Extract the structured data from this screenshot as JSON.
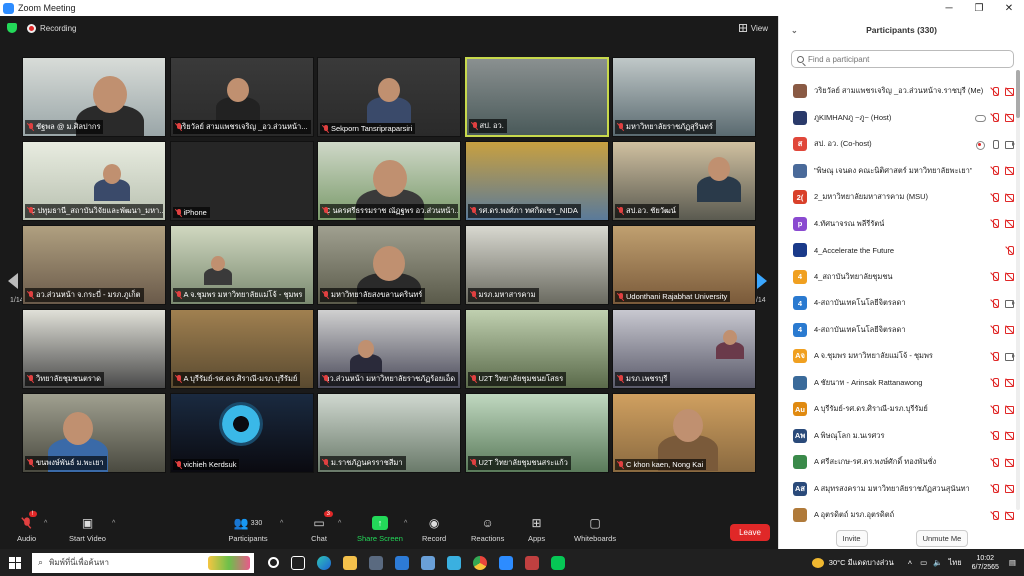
{
  "window": {
    "title": "Zoom Meeting"
  },
  "meeting": {
    "recording_label": "Recording",
    "view_label": "View",
    "page_indicator_left": "1/14",
    "page_indicator_right": "1/14",
    "tiles": [
      {
        "name": "ชัฐพล @ ม.ศิลปากร",
        "active": false
      },
      {
        "name": "วริยวัลย์  สามแพชรเจริญ _อว.ส่วนหน้า...",
        "active": false
      },
      {
        "name": "Sekporn Tansripraparsiri",
        "active": false
      },
      {
        "name": "สป. อว.",
        "active": true
      },
      {
        "name": "มหาวิทยาลัยราชภัฏสุรินทร์",
        "active": false
      },
      {
        "name": "C ปทุมธานี_สถาบันวิจัยและพัฒนา_มหา...",
        "active": false
      },
      {
        "name": "iPhone",
        "active": false
      },
      {
        "name": "C นครศรีธรรมราช ณัฏฐพร อว.ส่วนหน้า...",
        "active": false
      },
      {
        "name": "รศ.ดร.พงศ์ภา ทศกิดเชร_NIDA",
        "active": false
      },
      {
        "name": "สป.อว. ชัยวัฒน์",
        "active": false
      },
      {
        "name": "อว.ส่วนหน้า จ.กระบี่ - มรภ.ภูเก็ต",
        "active": false
      },
      {
        "name": "A จ.ชุมพร มหาวิทยาลัยแม่โจ้ - ชุมพร",
        "active": false
      },
      {
        "name": "มหาวิทยาลัยสงขลานครินทร์",
        "active": false
      },
      {
        "name": "มรภ.มหาสารคาม",
        "active": false
      },
      {
        "name": "Udonthani Rajabhat University",
        "active": false
      },
      {
        "name": "วิทยาลัยชุมชนตราด",
        "active": false
      },
      {
        "name": "A บุรีรัมย์-รศ.ดร.ศิราณี-มรภ.บุรีรัมย์",
        "active": false
      },
      {
        "name": "อว.ส่วนหน้า มหาวิทยาลัยราชภัฏร้อยเอ็ด",
        "active": false
      },
      {
        "name": "U2T วิทยาลัยชุมชนยโสธร",
        "active": false
      },
      {
        "name": "มรภ.เพชรบุรี",
        "active": false
      },
      {
        "name": "ขนพงษ์พันธ์ ม.พะเยา",
        "active": false
      },
      {
        "name": "vichieh Kerdsuk",
        "active": false
      },
      {
        "name": "ม.ราชภัฏนครราชสีมา",
        "active": false
      },
      {
        "name": "U2T วิทยาลัยชุมชนสระแก้ว",
        "active": false
      },
      {
        "name": "C khon kaen, Nong Kai",
        "active": false
      }
    ]
  },
  "toolbar": {
    "audio_label": "Audio",
    "video_label": "Start Video",
    "participants_label": "Participants",
    "participants_count": "330",
    "chat_label": "Chat",
    "chat_badge": "3",
    "share_label": "Share Screen",
    "record_label": "Record",
    "reactions_label": "Reactions",
    "apps_label": "Apps",
    "whiteboards_label": "Whiteboards",
    "leave_label": "Leave"
  },
  "panel": {
    "title": "Participants (330)",
    "search_placeholder": "Find a participant",
    "invite_label": "Invite",
    "unmute_label": "Unmute Me",
    "participants": [
      {
        "avatar": "",
        "color": "#8a5a44",
        "name": "วริยวัลย์  สามแพชรเจริญ _อว.ส่วนหน้าจ.ราชบุรี (Me)",
        "icons": [
          "mic-red",
          "cam-red"
        ]
      },
      {
        "avatar": "",
        "color": "#2a3a6a",
        "name": "ภูKIMHANภู  ~ภู~ (Host)",
        "icons": [
          "cloud",
          "mic-red",
          "cam-red"
        ]
      },
      {
        "avatar": "ส",
        "color": "#e0473a",
        "name": "สป. อว. (Co-host)",
        "icons": [
          "rec",
          "mic-gray",
          "cam-gray"
        ]
      },
      {
        "avatar": "",
        "color": "#4a6a9a",
        "name": "\"พิษณุ เจนดง คณะนิติศาสตร์ มหาวิทยาลัยพะเยา\"",
        "icons": [
          "mic-red",
          "cam-red"
        ]
      },
      {
        "avatar": "2(",
        "color": "#d9402a",
        "name": "2_มหาวิทยาลัยมหาสารคาม (MSU)",
        "icons": [
          "mic-red",
          "cam-red"
        ]
      },
      {
        "avatar": "p",
        "color": "#8a4ad0",
        "name": "4.ทัศนาจรณ พลีรีรัตน์",
        "icons": [
          "mic-red",
          "cam-red"
        ]
      },
      {
        "avatar": "",
        "color": "#1a3a8a",
        "name": "4_Accelerate the Future",
        "icons": [
          "mic-red"
        ]
      },
      {
        "avatar": "4",
        "color": "#f0a020",
        "name": "4_สถาบันวิทยาลัยชุมชน",
        "icons": [
          "mic-red",
          "cam-red"
        ]
      },
      {
        "avatar": "4",
        "color": "#2a7ad0",
        "name": "4-สถาบันเทคโนโลยีจิตรลดา",
        "icons": [
          "mic-red",
          "cam-gray"
        ]
      },
      {
        "avatar": "4",
        "color": "#2a7ad0",
        "name": "4-สถาบันเทคโนโลยีจิตรลดา",
        "icons": [
          "mic-red",
          "cam-red"
        ]
      },
      {
        "avatar": "Aจ",
        "color": "#f0a020",
        "name": "A จ.ชุมพร มหาวิทยาลัยแม่โจ้ - ชุมพร",
        "icons": [
          "mic-red",
          "cam-gray"
        ]
      },
      {
        "avatar": "",
        "color": "#3a6a9a",
        "name": "A ชัยนาท - Arinsak Rattanawong",
        "icons": [
          "mic-red",
          "cam-red"
        ]
      },
      {
        "avatar": "Au",
        "color": "#e08a10",
        "name": "A บุรีรัมย์-รศ.ดร.ศิราณี-มรภ.บุรีรัมย์",
        "icons": [
          "mic-red",
          "cam-red"
        ]
      },
      {
        "avatar": "Aพ",
        "color": "#2a4a7a",
        "name": "A พิษณุโลก ม.นเรศวร",
        "icons": [
          "mic-red",
          "cam-red"
        ]
      },
      {
        "avatar": "",
        "color": "#3a8a4a",
        "name": "A ศรีสะเกษ-รศ.ดร.พงษ์ศักดิ์ ทองพันชั่ง",
        "icons": [
          "mic-red",
          "cam-red"
        ]
      },
      {
        "avatar": "Aส",
        "color": "#2a4a7a",
        "name": "A สมุทรสงคราม มหาวิทยาลัยราชภัฏสวนสุนันทา",
        "icons": [
          "mic-red",
          "cam-red"
        ]
      },
      {
        "avatar": "",
        "color": "#b07a3a",
        "name": "A อุตรดิตถ์ มรภ.อุตรดิตถ์",
        "icons": [
          "mic-red",
          "cam-red"
        ]
      }
    ]
  },
  "taskbar": {
    "search_placeholder": "พิมพ์ที่นี่เพื่อค้นหา",
    "weather": "30°C  มีแดดบางส่วน",
    "lang": "ไทย",
    "time": "10:02",
    "date": "6/7/2565"
  }
}
